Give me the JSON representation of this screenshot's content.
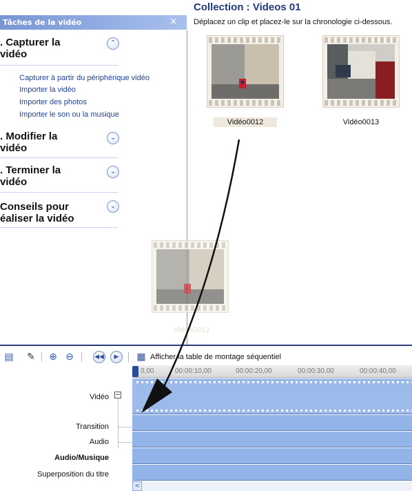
{
  "task_pane": {
    "header": "Tâches de la vidéo",
    "close": "×",
    "sections": [
      {
        "title": ". Capturer la\nvidéo",
        "expanded": true,
        "chevron": "⌃"
      },
      {
        "title": ". Modifier la\nvidéo",
        "expanded": false,
        "chevron": "⌄"
      },
      {
        "title": ". Terminer la\nvidéo",
        "expanded": false,
        "chevron": "⌄"
      },
      {
        "title": "Conseils pour\néaliser la vidéo",
        "expanded": false,
        "chevron": "⌄"
      }
    ],
    "capture_links": [
      "Capturer à partir du périphérique vidéo",
      "Importer la vidéo",
      "Importer des photos",
      "Importer le son ou la musique"
    ]
  },
  "collection": {
    "title": "Collection : Videos 01",
    "subtitle": "Déplacez un clip et placez-le sur la chronologie ci-dessous.",
    "clips": [
      {
        "label": "Vidéo0012",
        "selected": true
      },
      {
        "label": "Vidéo0013",
        "selected": false
      }
    ],
    "drag_ghost_label": "Vidéo0012"
  },
  "toolbar": {
    "toggle_storyboard_label": "Afficher la table de montage séquentiel",
    "icons": [
      "storyboard-icon",
      "audio-levels-icon",
      "zoom-in-icon",
      "zoom-out-icon",
      "rewind-icon",
      "play-icon",
      "filmstrip-icon"
    ]
  },
  "timeline": {
    "ruler_ticks": [
      "0,00",
      "00:00:10,00",
      "00:00:20,00",
      "00:00:30,00",
      "00:00:40,00"
    ],
    "tracks": [
      {
        "label": "Vidéo",
        "bold": false,
        "expander": "−"
      },
      {
        "label": "Transition",
        "bold": false
      },
      {
        "label": "Audio",
        "bold": false
      },
      {
        "label": "Audio/Musique",
        "bold": true
      },
      {
        "label": "Superposition du titre",
        "bold": false
      }
    ],
    "scroll_left": "<"
  },
  "colors": {
    "header_blue": "#7896d4",
    "track_blue": "#93b4e8",
    "link_blue": "#1c3fa6"
  }
}
